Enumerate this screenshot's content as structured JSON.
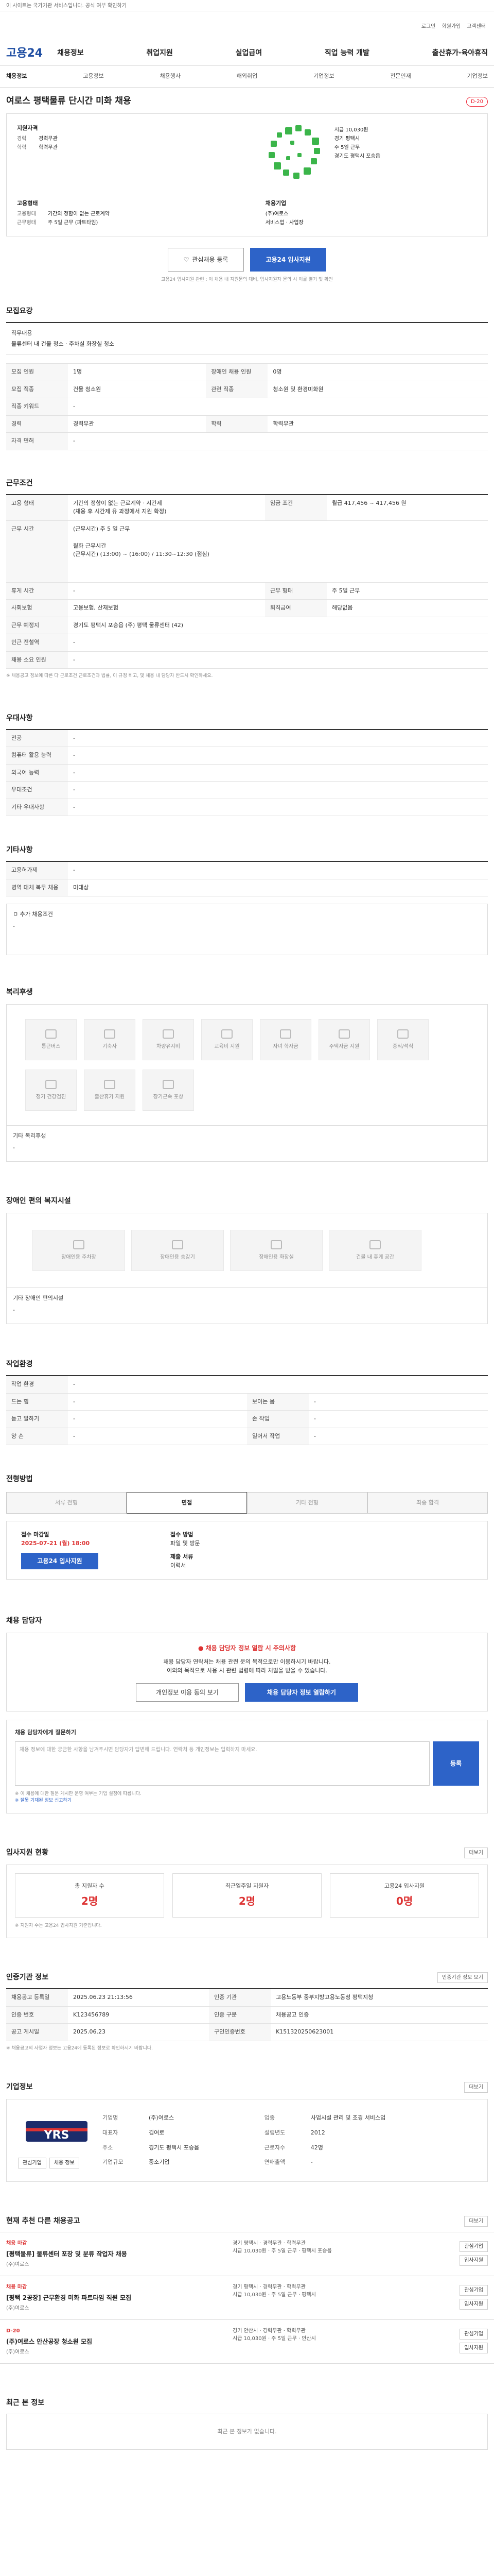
{
  "top": {
    "notice": "이 사이트는 국가기관 서비스입니다. 공식 여부 확인하기",
    "links": [
      "로그인",
      "회원가입",
      "고객센터"
    ]
  },
  "gnb": {
    "logo": "고용24",
    "menu": [
      "채용정보",
      "취업지원",
      "실업급여",
      "직업 능력 개발",
      "출산휴가·육아휴직"
    ]
  },
  "lnb": {
    "items": [
      "채용정보",
      "고용정보",
      "채용행사",
      "해외취업",
      "기업정보",
      "전문인재",
      "기업정보"
    ]
  },
  "job": {
    "title": "여로스 평택물류 단시간 미화 채용",
    "dday": "D-20",
    "apply_label": "지원자격",
    "career_k": "경력",
    "career_v": "경력무관",
    "edu_k": "학력",
    "edu_v": "학력무관",
    "cond_label": "근무조건",
    "cond": [
      {
        "k": "임금",
        "v": "시급 10,030원"
      },
      {
        "k": "지역",
        "v": "경기 평택시"
      },
      {
        "k": "근무형태",
        "v": "주 5일 근무"
      }
    ],
    "emp_label": "고용형태",
    "emp": [
      {
        "k": "고용형태",
        "v": "기간의 정함이 없는 근로계약"
      },
      {
        "k": "근무형태",
        "v": "주 5일 근무 (파트타임)"
      }
    ],
    "right_label": "채용기업",
    "company_name": "(주)여로스",
    "company_addr": "경기도 평택시 포승읍",
    "company_info": "서비스업 · 사업장",
    "company_tel": "평택시 포승읍",
    "scrap_btn": "관심채용 등록",
    "apply_btn": "고용24 입사지원",
    "note": "고용24 입사지원 관련 : 이 채용 내 지원문의 대비, 입사지원자 문의 시 이를 열기 및 확인"
  },
  "recruit": {
    "title": "모집요강",
    "duty_label": "직무내용",
    "duty_text": "물류센터 내 건물 청소 · 주차실 화장실 청소",
    "rows": [
      [
        "모집 인원",
        "1명",
        "장애인 채용 인원",
        "0명"
      ],
      [
        "모집 직종",
        "건물 청소원",
        "관련 직종",
        "청소원 및 환경미화원"
      ],
      [
        "직종 키워드",
        "-",
        "",
        ""
      ],
      [
        "경력",
        "경력무관",
        "학력",
        "학력무관"
      ],
      [
        "자격 면허",
        "-",
        "",
        ""
      ]
    ]
  },
  "work": {
    "title": "근무조건",
    "rows": [
      [
        "고용 형태",
        "기간의 정함이 없는 근로계약 · 시간제\n(채용 후 시간제 유 과정에서 지원 확정)",
        "임금 조건",
        "월급 417,456 ~ 417,456 원"
      ],
      [
        "근무 시간",
        "(근무시간) 주 5 일 근무\n\n월화 근무시간\n(근무시간) (13:00) ~ (16:00) / 11:30~12:30 (점심)",
        "",
        ""
      ],
      [
        "휴게 시간",
        "-",
        "근무 형태",
        "주 5일 근무"
      ],
      [
        "사회보험",
        "고용보험, 산재보험",
        "퇴직급여",
        "해당없음"
      ],
      [
        "근무 예정지",
        "경기도 평택시 포승읍 (주) 평택 물류센터 (42)",
        "",
        ""
      ],
      [
        "인근 전철역",
        "-",
        "",
        ""
      ],
      [
        "채용 소요 인원",
        "-",
        "",
        ""
      ]
    ],
    "note": "※ 채용공고 정보에 따른 다 근로조건 근로조건과 법률, 이 규정 비고, 및 채용 내 담당자 반드시 확인하세요."
  },
  "pref": {
    "title": "우대사항",
    "rows": [
      [
        "전공",
        "-"
      ],
      [
        "컴퓨터 활용 능력",
        "-"
      ],
      [
        "외국어 능력",
        "-"
      ],
      [
        "우대조건",
        "-"
      ],
      [
        "기타 우대사항",
        "-"
      ]
    ]
  },
  "etc": {
    "title": "기타사항",
    "rows": [
      [
        "고용허가제",
        "-"
      ],
      [
        "병역 대체 복무 채용",
        "미대상"
      ]
    ],
    "sub": "ㅁ 추가 채용조건",
    "sub_val": "-"
  },
  "welfare": {
    "title": "복리후생",
    "items": [
      "통근버스",
      "기숙사",
      "차량유지비",
      "교육비 지원",
      "자녀 학자금",
      "주택자금 지원",
      "중식/석식",
      "정기 건강검진",
      "출산휴가 지원",
      "장기근속 포상"
    ],
    "etc_label": "기타 복리후생",
    "etc_val": "-"
  },
  "disability": {
    "title": "장애인 편의 복지시설",
    "items": [
      "장애인용 주차장",
      "장애인용 승강기",
      "장애인용 화장실",
      "건물 내 휴게 공간"
    ],
    "etc_label": "기타 장애인 편의시설",
    "etc_val": "-"
  },
  "workenv": {
    "title": "작업환경",
    "rows": [
      [
        "작업 환경",
        "-",
        "",
        ""
      ],
      [
        "드는 힘",
        "-",
        "보이는 몸",
        "-"
      ],
      [
        "듣고 말하기",
        "-",
        "손 작업",
        "-"
      ],
      [
        "양 손",
        "-",
        "일어서 작업",
        "-"
      ]
    ]
  },
  "procedure": {
    "title": "전형방법",
    "tabs": [
      "서류 전형",
      "면접",
      "기타 전형",
      "최종 합격"
    ],
    "deadline_label": "접수 마감일",
    "deadline": "2025-07-21 (월) 18:00",
    "method_label": "접수 방법",
    "method": "파일 및 방문",
    "apply_btn": "고용24 입사지원",
    "docs_label": "제출 서류",
    "docs": "이력서"
  },
  "contact": {
    "title": "채용 담당자",
    "alert": "채용 담당자 정보 열람 시 주의사항",
    "text1": "채용 담당자 연락처는 채용 관련 문의 목적으로만 이용하시기 바랍니다.",
    "text2": "이외의 목적으로 사용 시 관련 법령에 따라 처벌을 받을 수 있습니다.",
    "btn1": "개인정보 이용 동의 보기",
    "btn2": "채용 담당자 정보 열람하기"
  },
  "inquiry": {
    "title": "채용 담당자에게 질문하기",
    "placeholder": "채용 정보에 대한 궁금한 사항을 남겨주시면 담당자가 답변해 드립니다. 연락처 등 개인정보는 입력하지 마세요.",
    "btn": "등록",
    "note1": "※ 이 채용에 대한 질문 게시판 운영 여부는 기업 설정에 따릅니다.",
    "note2": "※ 잘못 기재된 정보 신고하기"
  },
  "stats": {
    "title": "입사지원 현황",
    "more": "더보기",
    "items": [
      {
        "name": "총 지원자 수",
        "num": "2명"
      },
      {
        "name": "최근일주일 지원자",
        "num": "2명"
      },
      {
        "name": "고용24 입사지원",
        "num": "0명"
      }
    ],
    "note": "※ 지원자 수는 고용24 입사지원 기준입니다."
  },
  "info": {
    "title": "인증기관 정보",
    "more": "인증기관 정보 보기",
    "rows": [
      [
        "채용공고 등록일",
        "2025.06.23 21:13:56",
        "인증 기관",
        "고용노동부 중부지방고용노동청 평택지청"
      ],
      [
        "인증 번호",
        "K123456789",
        "인증 구분",
        "채용공고 인증"
      ],
      [
        "공고 게시일",
        "2025.06.23",
        "구인인증번호",
        "K151320250623001"
      ]
    ],
    "note": "※ 채용공고의 사업자 정보는 고용24에 등록된 정보로 확인하시기 바랍니다."
  },
  "company": {
    "title": "기업정보",
    "more": "더보기",
    "logo": "YRS",
    "rows": [
      [
        "기업명",
        "(주)여로스",
        "업종",
        "사업시설 관리 및 조경 서비스업"
      ],
      [
        "대표자",
        "김여로",
        "설립년도",
        "2012"
      ],
      [
        "주소",
        "경기도 평택시 포승읍",
        "근로자수",
        "42명"
      ],
      [
        "기업규모",
        "중소기업",
        "연매출액",
        "-"
      ]
    ],
    "btn1": "관심기업",
    "btn2": "채용 정보"
  },
  "related": {
    "title": "현재 추천 다른 채용공고",
    "more": "더보기",
    "items": [
      {
        "tag": "채용 마감",
        "company": "(주)여로스",
        "title": "[평택물류] 물류센터 포장 및 분류 작업자 채용",
        "sub": "경기 평택시 · 경력무관 · 학력무관",
        "meta": "시급 10,030원 · 주 5일 근무 · 평택시 포승읍",
        "btn1": "관심기업",
        "btn2": "입사지원"
      },
      {
        "tag": "채용 마감",
        "company": "(주)여로스",
        "title": "[평택 2공장] 근무환경 미화 파트타임 직원 모집",
        "sub": "경기 평택시 · 경력무관 · 학력무관",
        "meta": "시급 10,030원 · 주 5일 근무 · 평택시",
        "btn1": "관심기업",
        "btn2": "입사지원"
      },
      {
        "tag": "D-20",
        "company": "(주)여로스",
        "title": "(주)여로스 안산공장 청소원 모집",
        "sub": "경기 안산시 · 경력무관 · 학력무관",
        "meta": "시급 10,030원 · 주 5일 근무 · 안산시",
        "btn1": "관심기업",
        "btn2": "입사지원"
      }
    ]
  },
  "recent": {
    "title": "최근 본 정보",
    "empty": "최근 본 정보가 없습니다."
  }
}
